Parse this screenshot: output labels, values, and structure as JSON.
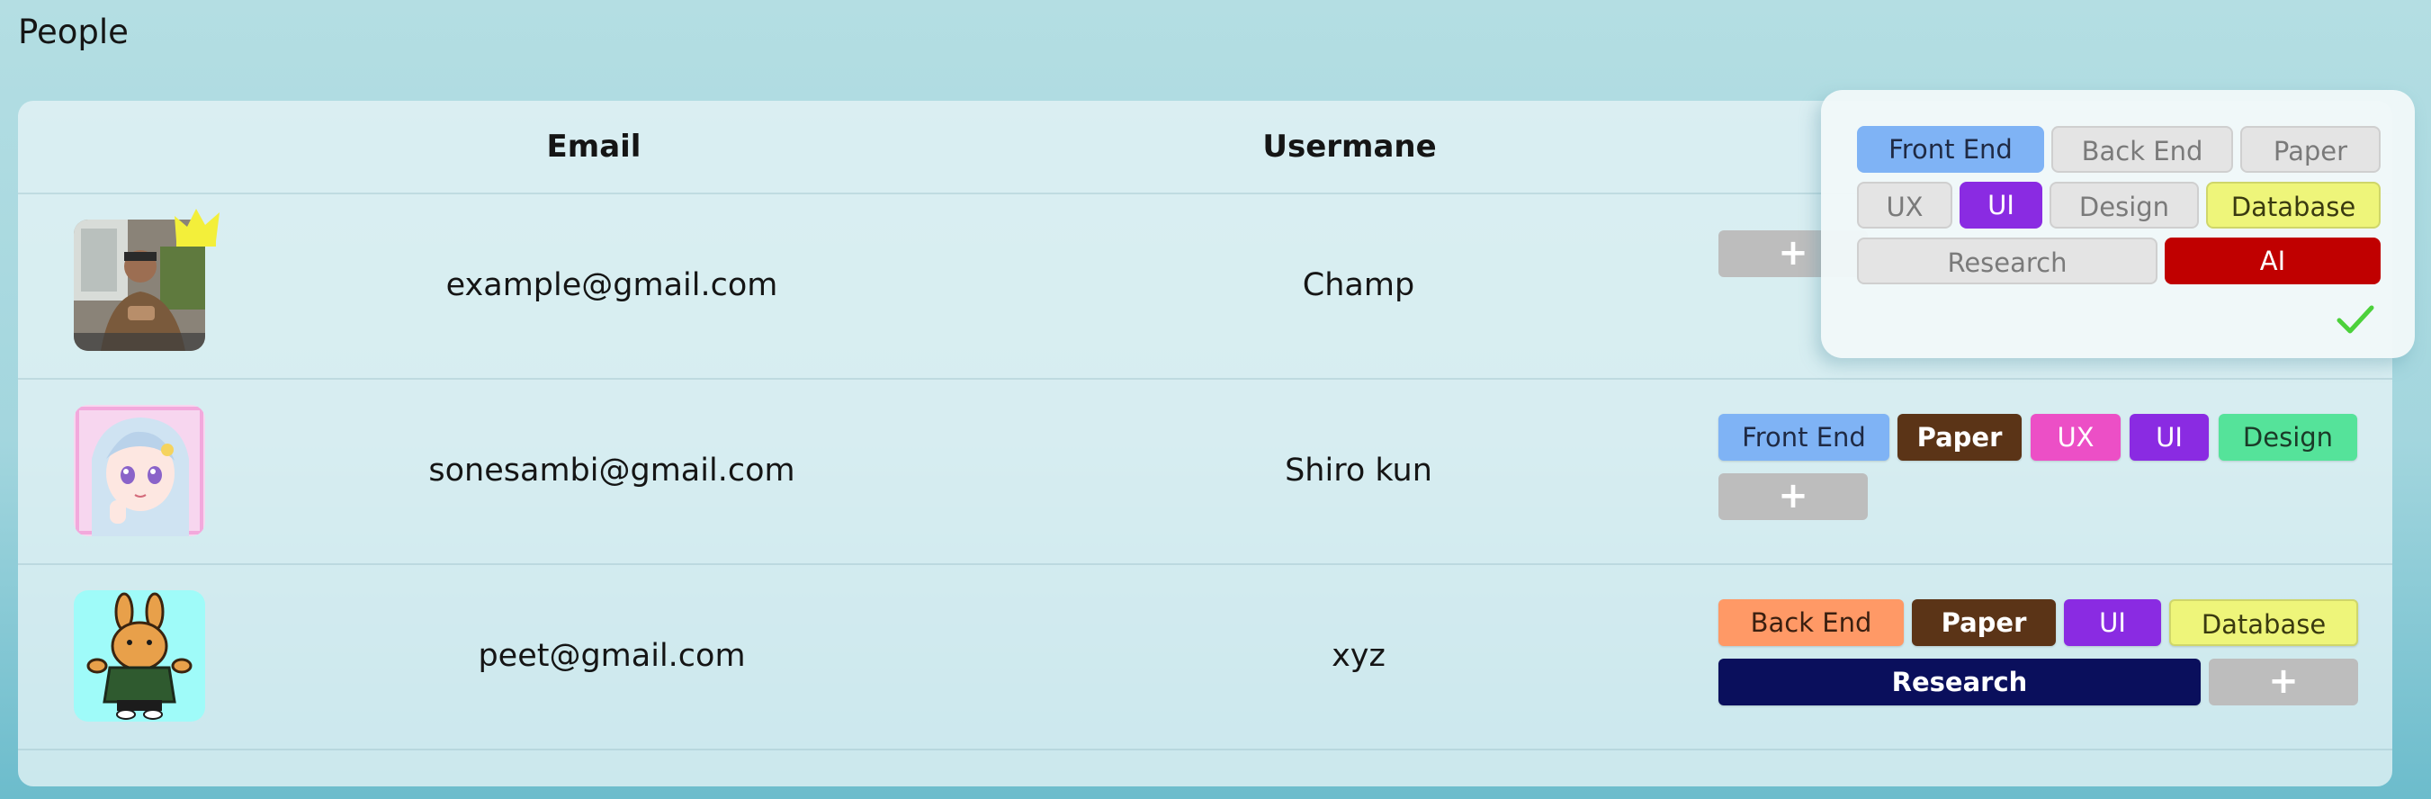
{
  "page": {
    "title": "People"
  },
  "table": {
    "columns": {
      "email": "Email",
      "username": "Usermane"
    },
    "rows": [
      {
        "email": "example@gmail.com",
        "username": "Champ",
        "avatar": "person-photo-with-crown",
        "tags": [],
        "add_label": "+"
      },
      {
        "email": "sonesambi@gmail.com",
        "username": "Shiro kun",
        "avatar": "anime-girl-avatar",
        "tags": [
          {
            "label": "Front End",
            "bg": "#7fb3f5",
            "fg": "#1f2a44"
          },
          {
            "label": "Paper",
            "bg": "#5b3417",
            "fg": "#ffffff"
          },
          {
            "label": "UX",
            "bg": "#ec4fc6",
            "fg": "#ffffff"
          },
          {
            "label": "UI",
            "bg": "#8a2be2",
            "fg": "#ffffff"
          },
          {
            "label": "Design",
            "bg": "#55e39a",
            "fg": "#1b3a28"
          }
        ],
        "add_label": "+"
      },
      {
        "email": "peet@gmail.com",
        "username": "xyz",
        "avatar": "rabbit-mascot-avatar",
        "tags": [
          {
            "label": "Back End",
            "bg": "#ff9966",
            "fg": "#3a1f10"
          },
          {
            "label": "Paper",
            "bg": "#5b3417",
            "fg": "#ffffff"
          },
          {
            "label": "UI",
            "bg": "#8a2be2",
            "fg": "#ffffff"
          },
          {
            "label": "Database",
            "bg": "#eef57a",
            "fg": "#3a3a10"
          },
          {
            "label": "Research",
            "bg": "#0a0f5c",
            "fg": "#ffffff"
          }
        ],
        "add_label": "+"
      }
    ]
  },
  "tag_picker": {
    "options": [
      {
        "label": "Front End",
        "selected": true,
        "bg": "#7fb3f5",
        "fg": "#1f2a44"
      },
      {
        "label": "Back End",
        "selected": false
      },
      {
        "label": "Paper",
        "selected": false
      },
      {
        "label": "UX",
        "selected": false
      },
      {
        "label": "UI",
        "selected": true,
        "bg": "#8a2be2",
        "fg": "#ffffff"
      },
      {
        "label": "Design",
        "selected": false
      },
      {
        "label": "Database",
        "selected": true,
        "bg": "#eef57a",
        "fg": "#3a3a10"
      },
      {
        "label": "Research",
        "selected": false
      },
      {
        "label": "AI",
        "selected": true,
        "bg": "#c00000",
        "fg": "#ffffff"
      }
    ],
    "confirm_icon": "checkmark-icon",
    "confirm_color": "#4cd13b"
  }
}
